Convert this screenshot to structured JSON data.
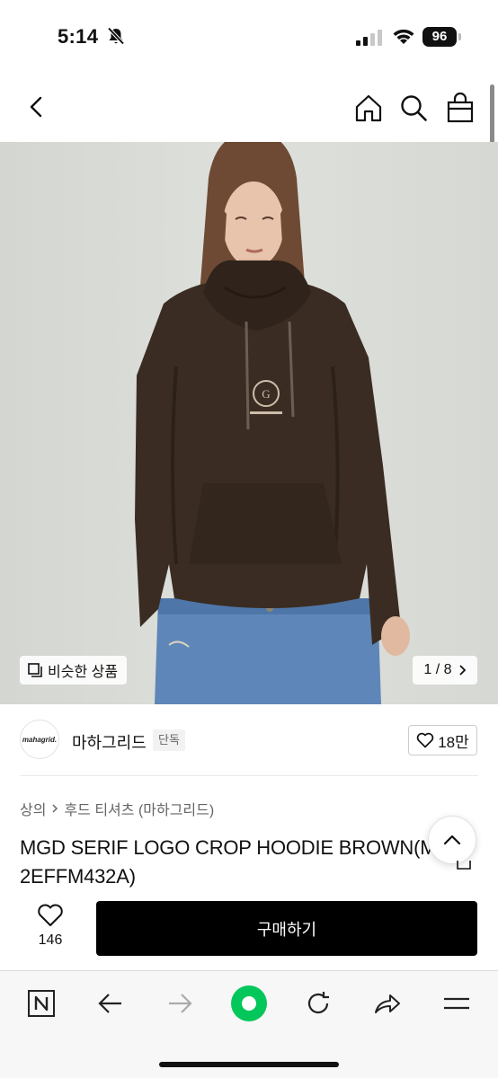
{
  "status_bar": {
    "time": "5:14",
    "battery": "96",
    "icons": [
      "bell-slash-icon",
      "signal-icon",
      "wifi-icon",
      "battery-icon"
    ]
  },
  "header": {
    "icons": [
      "chevron-left-icon",
      "home-icon",
      "search-icon",
      "shopping-bag-icon"
    ]
  },
  "product_image": {
    "similar_label": "비슷한 상품",
    "page_indicator": "1 / 8"
  },
  "brand": {
    "logo_text": "mahagrid.",
    "name": "마하그리드",
    "badge": "단독",
    "likes": "18만"
  },
  "breadcrumb": {
    "category": "상의",
    "subcategory": "후드 티셔츠 (마하그리드)"
  },
  "product": {
    "title": "MGD SERIF LOGO CROP HOODIE BROWN(MG2EFFM432A)"
  },
  "purchase": {
    "wish_count": "146",
    "buy_label": "구매하기"
  },
  "browser_toolbar": {
    "icons": [
      "naver-n-icon",
      "arrow-left-icon",
      "arrow-right-icon",
      "green-home-icon",
      "refresh-icon",
      "share-arrow-icon",
      "menu-icon"
    ]
  },
  "colors": {
    "buy_button": "#000000",
    "accent_green": "#03c75a",
    "hoodie_brown": "#3a2c22",
    "jeans_blue": "#5f86b8"
  }
}
